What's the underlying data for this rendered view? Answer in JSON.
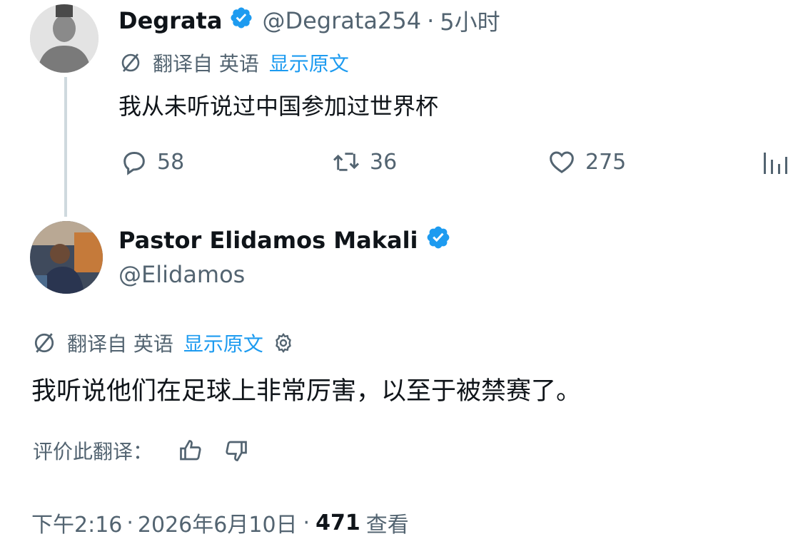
{
  "reply_parent": {
    "display_name": "Degrata",
    "handle": "@Degrata254",
    "separator": "·",
    "time_ago": "5小时",
    "translated_from": "翻译自 英语",
    "show_original": "显示原文",
    "text": "我从未听说过中国参加过世界杯",
    "actions": {
      "replies": "58",
      "reposts": "36",
      "likes": "275"
    }
  },
  "main_post": {
    "display_name": "Pastor Elidamos Makali",
    "handle": "@Elidamos",
    "translated_from": "翻译自 英语",
    "show_original": "显示原文",
    "text": "我听说他们在足球上非常厉害，以至于被禁赛了。",
    "rate_translation": "评价此翻译：",
    "footer": {
      "time": "下午2:16",
      "separator": "·",
      "date": "2026年6月10日",
      "views_count": "471",
      "views_label": "查看"
    }
  },
  "colors": {
    "accent": "#1d9bf0",
    "text": "#0f1419",
    "secondary": "#536471",
    "thread_line": "#cfd9de"
  },
  "icons": [
    "verified-badge-icon",
    "translate-icon",
    "reply-icon",
    "repost-icon",
    "like-icon",
    "analytics-icon",
    "gear-icon",
    "thumbs-up-icon",
    "thumbs-down-icon"
  ]
}
